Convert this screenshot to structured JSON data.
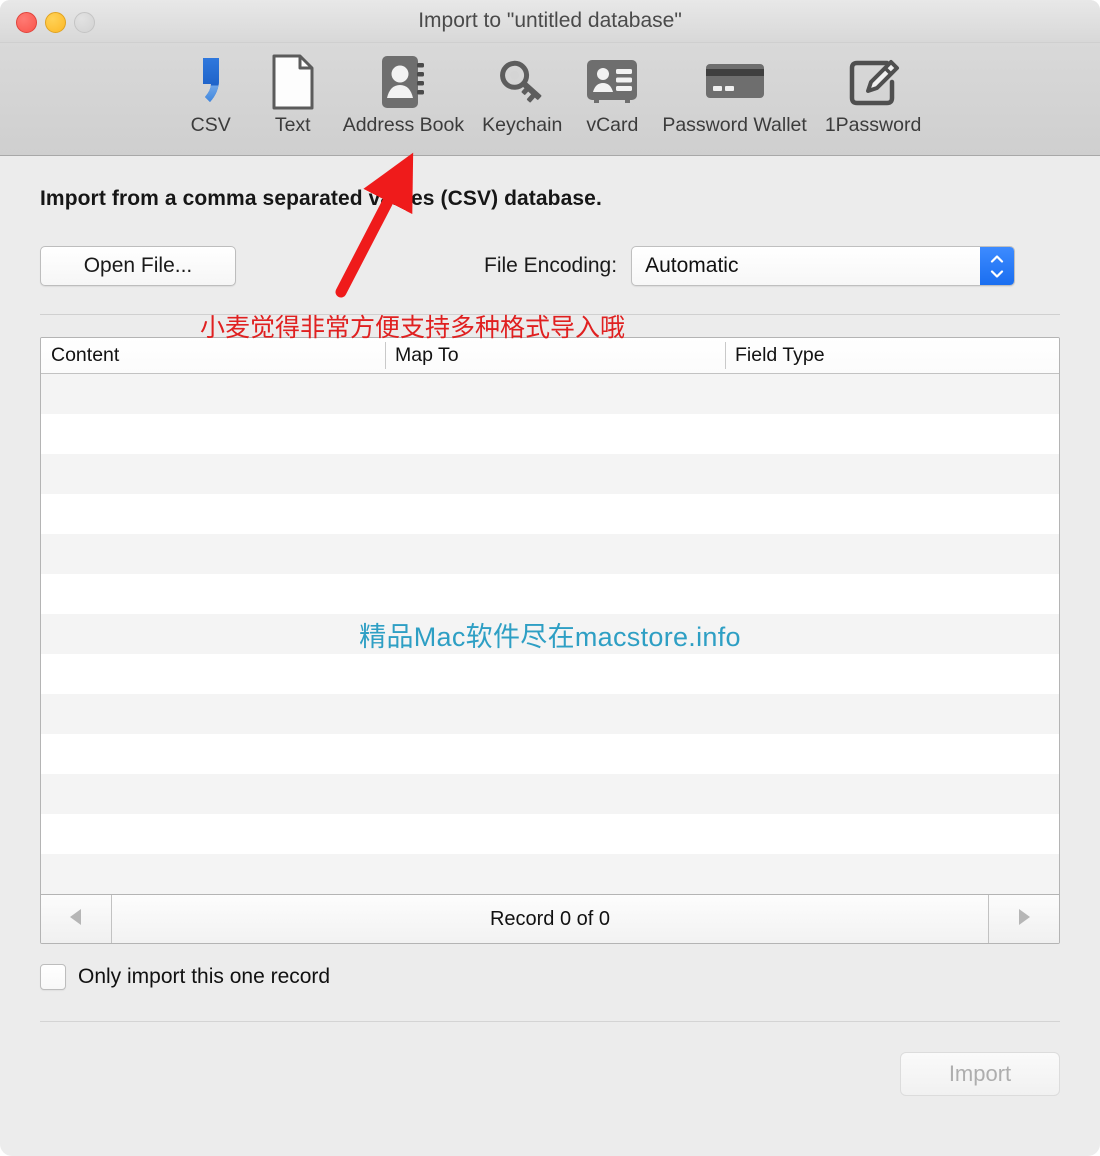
{
  "window": {
    "title": "Import to \"untitled database\"",
    "traffic_lights": [
      "close",
      "minimize",
      "zoom"
    ]
  },
  "toolbar": {
    "items": [
      {
        "label": "CSV",
        "icon": "csv-comma-icon"
      },
      {
        "label": "Text",
        "icon": "text-document-icon"
      },
      {
        "label": "Address Book",
        "icon": "address-book-icon"
      },
      {
        "label": "Keychain",
        "icon": "key-icon"
      },
      {
        "label": "vCard",
        "icon": "vcard-icon"
      },
      {
        "label": "Password Wallet",
        "icon": "credit-card-icon"
      },
      {
        "label": "1Password",
        "icon": "pencil-square-icon"
      }
    ]
  },
  "main": {
    "headline": "Import from a comma separated values (CSV) database.",
    "open_file_label": "Open File...",
    "encoding_label": "File Encoding:",
    "encoding_value": "Automatic",
    "table": {
      "columns": [
        "Content",
        "Map To",
        "Field Type"
      ],
      "rows": [],
      "row_count": 13
    },
    "watermark": "精品Mac软件尽在macstore.info",
    "nav": {
      "status": "Record 0 of 0",
      "prev_icon": "triangle-left-icon",
      "next_icon": "triangle-right-icon"
    },
    "checkbox_label": "Only import this one record",
    "checkbox_checked": false,
    "import_label": "Import",
    "import_disabled": true
  },
  "annotations": {
    "red_text": "小麦觉得非常方便支持多种格式导入哦",
    "arrow_color": "#ef1b1b"
  },
  "colors": {
    "accent_blue": "#2f7ff5",
    "watermark_teal": "#2e9fc4",
    "annotation_red": "#e02020",
    "window_bg": "#ececec",
    "toolbar_bg": "#d4d4d4"
  }
}
